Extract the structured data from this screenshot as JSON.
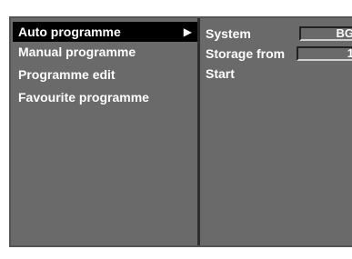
{
  "menu": {
    "items": [
      {
        "label": "Auto programme",
        "selected": true,
        "arrow": "▶"
      },
      {
        "label": "Manual programme",
        "selected": false
      },
      {
        "label": "Programme edit",
        "selected": false
      },
      {
        "label": "Favourite programme",
        "selected": false
      }
    ]
  },
  "settings": {
    "system": {
      "label": "System",
      "value": "BG"
    },
    "storage_from": {
      "label": "Storage from",
      "value": "1"
    },
    "start": {
      "label": "Start"
    }
  },
  "colors": {
    "panel_background": "#6a6a6a",
    "highlight": "#000000",
    "text": "#ffffff"
  }
}
